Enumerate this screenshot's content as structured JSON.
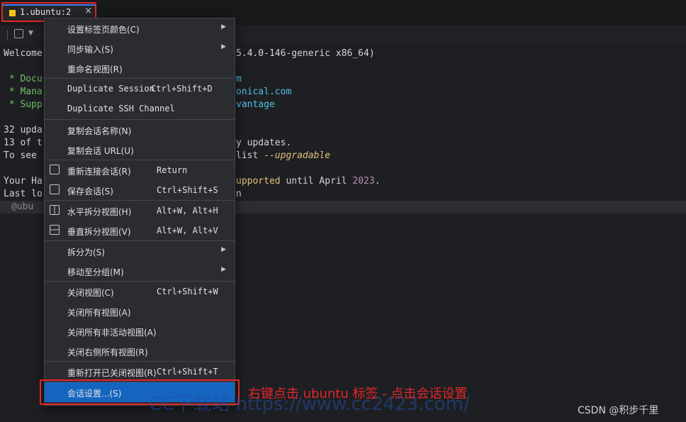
{
  "tab": {
    "title": "1.ubuntu:2",
    "close": "×",
    "dot_color": "#f5c518"
  },
  "terminal": {
    "lines": [
      {
        "a": "Welcome",
        "b": "5.4.0-146-generic x86_64)"
      },
      {
        "a": " * Docu",
        "b": "m"
      },
      {
        "a": " * Mana",
        "b": "onical.com"
      },
      {
        "a": " * Supp",
        "b": "vantage"
      },
      {
        "a": "32 upda",
        "b": ""
      },
      {
        "a": "13 of t",
        "b": "y updates."
      },
      {
        "a": "To see ",
        "b": "list",
        "c": " --upgradable"
      },
      {
        "a": "Your Ha",
        "b": "upported",
        "c": " until April ",
        "d": "2023",
        "e": "."
      },
      {
        "a": "Last lo",
        "b": "n"
      },
      {
        "a": "@ubu",
        "b": ""
      }
    ]
  },
  "menu": {
    "items": [
      {
        "label": "设置标签页颜色(C)",
        "arrow": "▶"
      },
      {
        "label": "同步输入(S)",
        "arrow": "▶"
      },
      {
        "label": "重命名视图(R)"
      },
      {
        "label": "Duplicate Session",
        "shortcut": "Ctrl+Shift+D"
      },
      {
        "label": "Duplicate SSH Channel"
      },
      {
        "label": "复制会话名称(N)"
      },
      {
        "label": "复制会话 URL(U)"
      },
      {
        "label": "重新连接会话(R)",
        "shortcut": "Return"
      },
      {
        "label": "保存会话(S)",
        "shortcut": "Ctrl+Shift+S"
      },
      {
        "label": "水平拆分视图(H)",
        "shortcut": "Alt+W, Alt+H"
      },
      {
        "label": "垂直拆分视图(V)",
        "shortcut": "Alt+W, Alt+V"
      },
      {
        "label": "拆分为(S)",
        "arrow": "▶"
      },
      {
        "label": "移动至分组(M)",
        "arrow": "▶"
      },
      {
        "label": "关闭视图(C)",
        "shortcut": "Ctrl+Shift+W"
      },
      {
        "label": "关闭所有视图(A)"
      },
      {
        "label": "关闭所有非活动视图(A)"
      },
      {
        "label": "关闭右侧所有视图(R)"
      },
      {
        "label": "重新打开已关闭视图(R)",
        "shortcut": "Ctrl+Shift+T"
      },
      {
        "label": "会话设置...(S)"
      }
    ]
  },
  "annotation": "右键点击 ubuntu 标签 - 点击会话设置",
  "watermark": {
    "site": "CC下载站  https://www.cc2423.com/",
    "author": "CSDN @积步千里"
  },
  "colors": {
    "accent": "#1565c0",
    "highlight": "#e3262a"
  }
}
